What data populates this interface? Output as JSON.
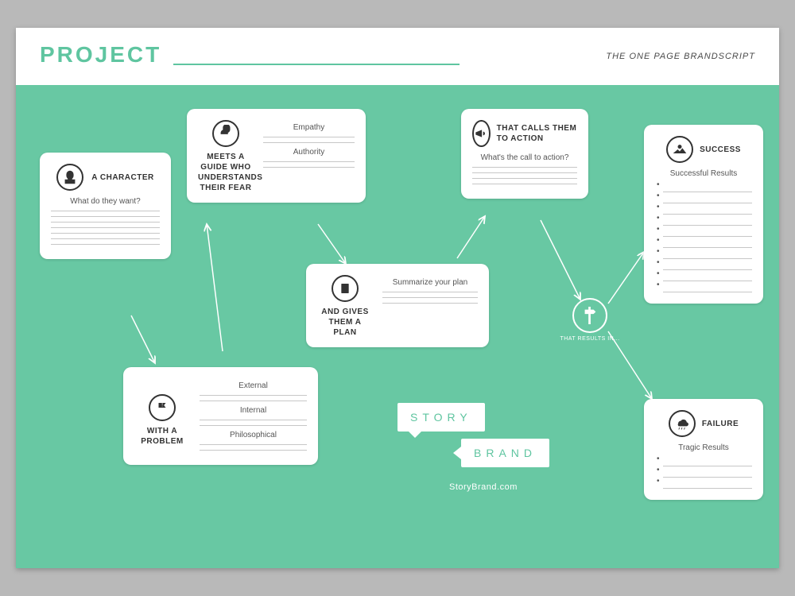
{
  "header": {
    "project_label": "PROJECT",
    "subtitle": "THE ONE PAGE BRANDSCRIPT"
  },
  "cards": {
    "character": {
      "title": "A CHARACTER",
      "prompt": "What do they want?"
    },
    "problem": {
      "title": "WITH A PROBLEM",
      "fields": {
        "external": "External",
        "internal": "Internal",
        "philosophical": "Philosophical"
      }
    },
    "guide": {
      "title": "MEETS A GUIDE WHO UNDERSTANDS THEIR FEAR",
      "fields": {
        "empathy": "Empathy",
        "authority": "Authority"
      }
    },
    "plan": {
      "title": "AND GIVES THEM A PLAN",
      "prompt": "Summarize your plan"
    },
    "cta": {
      "title": "THAT CALLS THEM TO ACTION",
      "prompt": "What's the call to action?"
    },
    "success": {
      "title": "SUCCESS",
      "prompt": "Successful Results"
    },
    "failure": {
      "title": "FAILURE",
      "prompt": "Tragic Results"
    }
  },
  "node": {
    "caption": "THAT RESULTS IN..."
  },
  "logo": {
    "line1": "STORY",
    "line2": "BRAND",
    "url": "StoryBrand.com"
  },
  "colors": {
    "accent": "#5fc5a0",
    "canvas": "#68c8a3"
  }
}
